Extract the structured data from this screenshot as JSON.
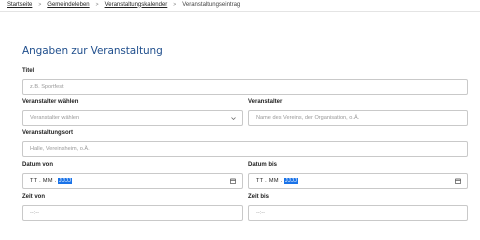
{
  "breadcrumb": {
    "items": [
      "Startseite",
      "Gemeindeleben",
      "Veranstaltungskalender"
    ],
    "current": "Veranstaltungseintrag",
    "separator": ">"
  },
  "form": {
    "title": "Angaben zur Veranstaltung",
    "titel": {
      "label": "Titel",
      "placeholder": "z.B. Sportfest"
    },
    "veranstalter_waehlen": {
      "label": "Veranstalter wählen",
      "placeholder": "Veranstalter wählen",
      "icon": "chevron-down-icon"
    },
    "veranstalter": {
      "label": "Veranstalter",
      "placeholder": "Name des Vereins, der Organisation, o.Ä."
    },
    "ort": {
      "label": "Veranstaltungsort",
      "placeholder": "Halle, Vereinsheim, o.Ä."
    },
    "datum_von": {
      "label": "Datum von",
      "value_a": "TT . MM . ",
      "value_b": "JJJJ",
      "icon": "calendar-icon"
    },
    "datum_bis": {
      "label": "Datum bis",
      "value_a": "TT . MM . ",
      "value_b": "JJJJ",
      "icon": "calendar-icon"
    },
    "zeit_von": {
      "label": "Zeit von",
      "value": "--:--"
    },
    "zeit_bis": {
      "label": "Zeit bis",
      "value": "--:--"
    }
  },
  "colors": {
    "title": "#1f4e8c",
    "border": "#c9c9c9",
    "highlight": "#1a73e8"
  }
}
